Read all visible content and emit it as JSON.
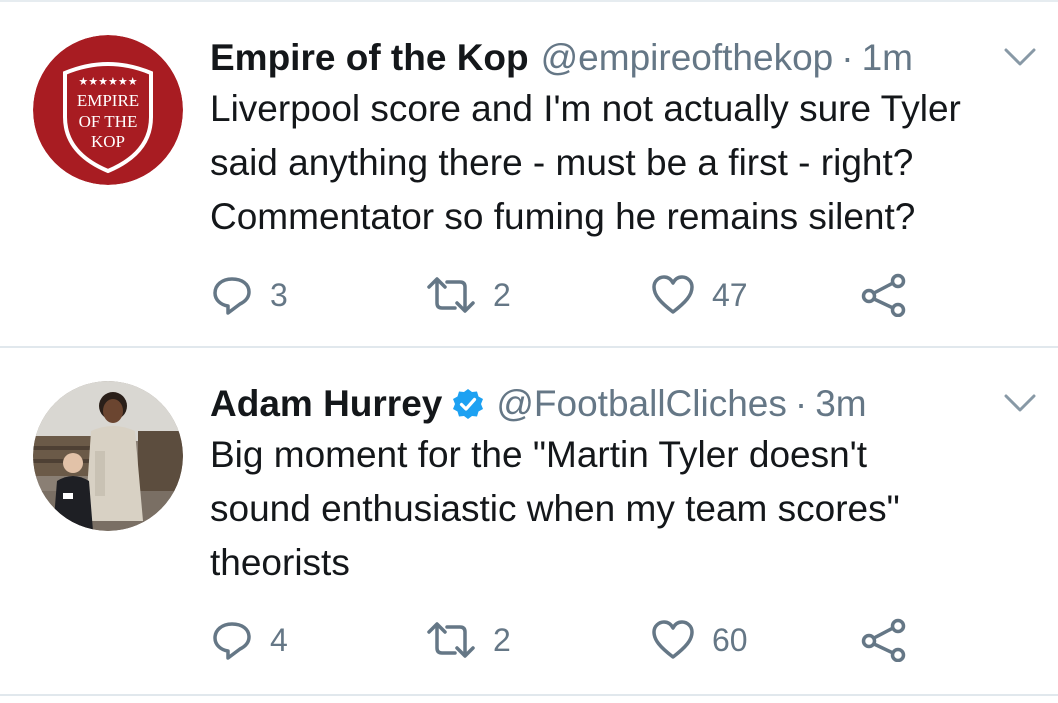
{
  "tweets": [
    {
      "name": "Empire of the Kop",
      "handle": "@empireofthekop",
      "separator": "·",
      "time": "1m",
      "verified": false,
      "avatar": {
        "stars": "★★★★★★",
        "line1": "EMPIRE",
        "line2": "OF THE",
        "line3": "KOP",
        "color": "#a81c22"
      },
      "text_lines": [
        "Liverpool score and I'm not actually sure Tyler",
        "said anything there - must be a first - right?",
        "Commentator so fuming he remains silent?"
      ],
      "counts": {
        "replies": "3",
        "retweets": "2",
        "likes": "47"
      },
      "icons": [
        "reply-icon",
        "retweet-icon",
        "like-icon",
        "share-icon",
        "chevron-down-icon"
      ]
    },
    {
      "name": "Adam Hurrey",
      "handle": "@FootballCliches",
      "separator": "·",
      "time": "3m",
      "verified": true,
      "text_lines": [
        "Big moment for the \"Martin Tyler doesn't",
        "sound enthusiastic when my team scores\"",
        "theorists"
      ],
      "counts": {
        "replies": "4",
        "retweets": "2",
        "likes": "60"
      },
      "icons": [
        "reply-icon",
        "retweet-icon",
        "like-icon",
        "share-icon",
        "chevron-down-icon",
        "verified-badge-icon"
      ]
    }
  ],
  "colors": {
    "text": "#14171a",
    "secondary": "#657786",
    "verified": "#1da1f2",
    "divider": "#e1e8ed"
  }
}
